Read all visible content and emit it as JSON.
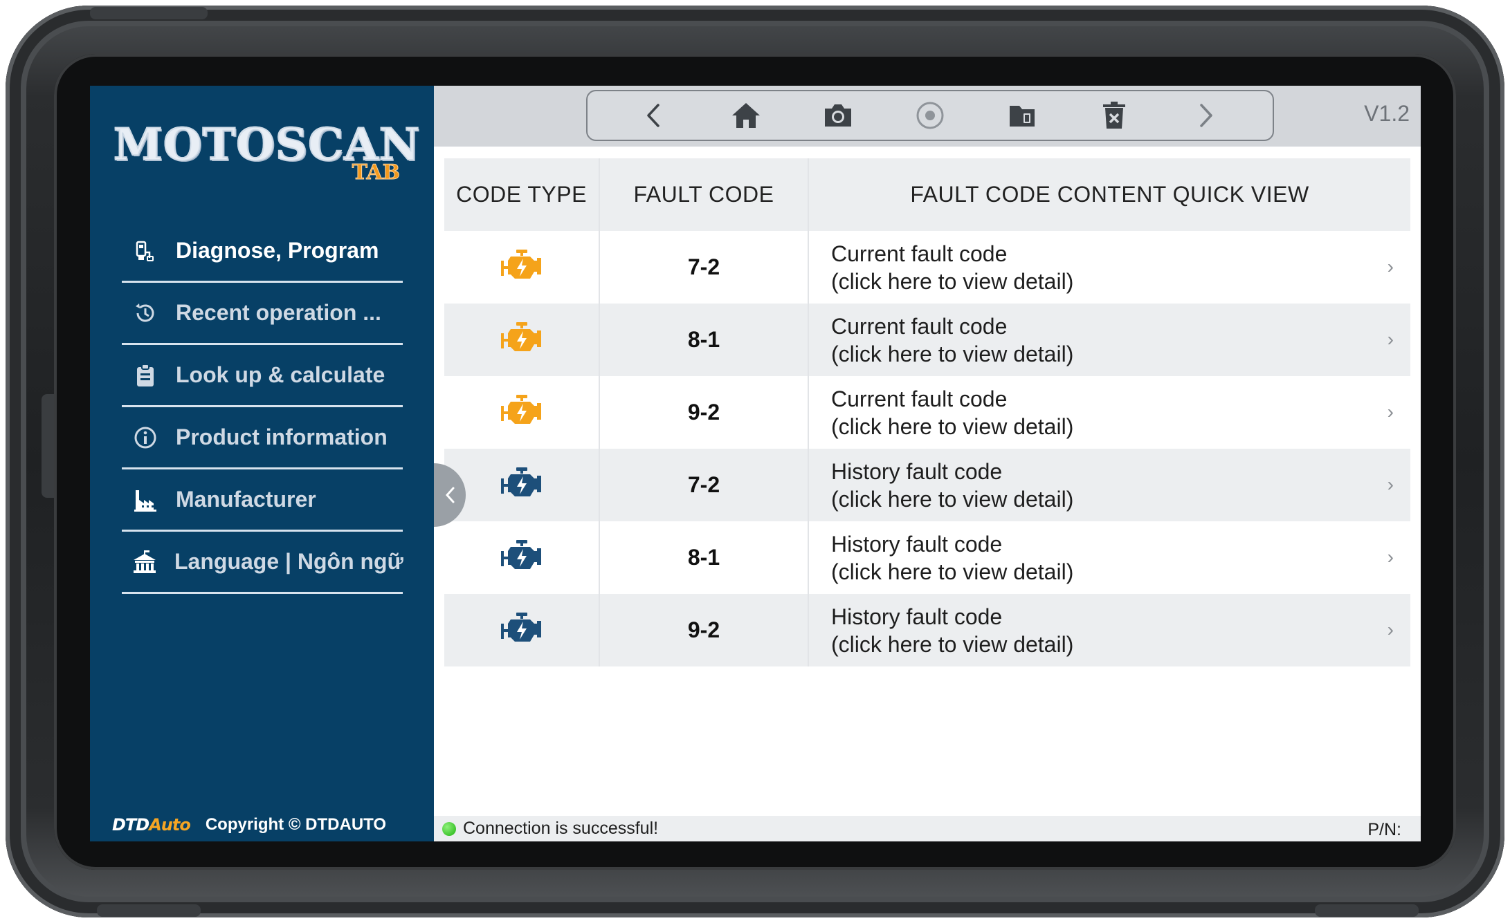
{
  "app": {
    "logo_main": "MOTOSCAN",
    "logo_sub": "TAB",
    "version": "V1.2"
  },
  "sidebar": {
    "items": [
      {
        "label": "Diagnose, Program",
        "icon": "diagnose-icon",
        "active": true
      },
      {
        "label": "Recent operation ...",
        "icon": "history-icon",
        "active": false
      },
      {
        "label": "Look up & calculate",
        "icon": "clipboard-icon",
        "active": false
      },
      {
        "label": "Product information",
        "icon": "info-icon",
        "active": false
      },
      {
        "label": "Manufacturer",
        "icon": "factory-icon",
        "active": false
      },
      {
        "label": "Language | Ngôn ngữ",
        "icon": "language-icon",
        "active": false
      }
    ],
    "footer_brand_a": "DTD",
    "footer_brand_b": "Auto",
    "copyright": "Copyright © DTDAUTO"
  },
  "toolbar": {
    "buttons": [
      "back-icon",
      "home-icon",
      "camera-icon",
      "record-icon",
      "folder-icon",
      "delete-icon",
      "forward-icon"
    ]
  },
  "table": {
    "headers": {
      "type": "CODE TYPE",
      "code": "FAULT CODE",
      "content": "FAULT CODE CONTENT QUICK VIEW"
    },
    "rows": [
      {
        "type": "current",
        "code": "7-2",
        "line1": "Current fault code",
        "line2": "(click here to view detail)"
      },
      {
        "type": "current",
        "code": "8-1",
        "line1": "Current fault code",
        "line2": "(click here to view detail)"
      },
      {
        "type": "current",
        "code": "9-2",
        "line1": "Current fault code",
        "line2": "(click here to view detail)"
      },
      {
        "type": "history",
        "code": "7-2",
        "line1": "History fault code",
        "line2": "(click here to view detail)"
      },
      {
        "type": "history",
        "code": "8-1",
        "line1": "History fault code",
        "line2": "(click here to view detail)"
      },
      {
        "type": "history",
        "code": "9-2",
        "line1": "History fault code",
        "line2": "(click here to view detail)"
      }
    ]
  },
  "status": {
    "connection": "Connection is successful!",
    "pn_label": "P/N:"
  },
  "colors": {
    "sidebar_bg": "#074066",
    "current_engine": "#f5a31a",
    "history_engine": "#1d4f7a",
    "status_ok": "#2ec41c"
  }
}
